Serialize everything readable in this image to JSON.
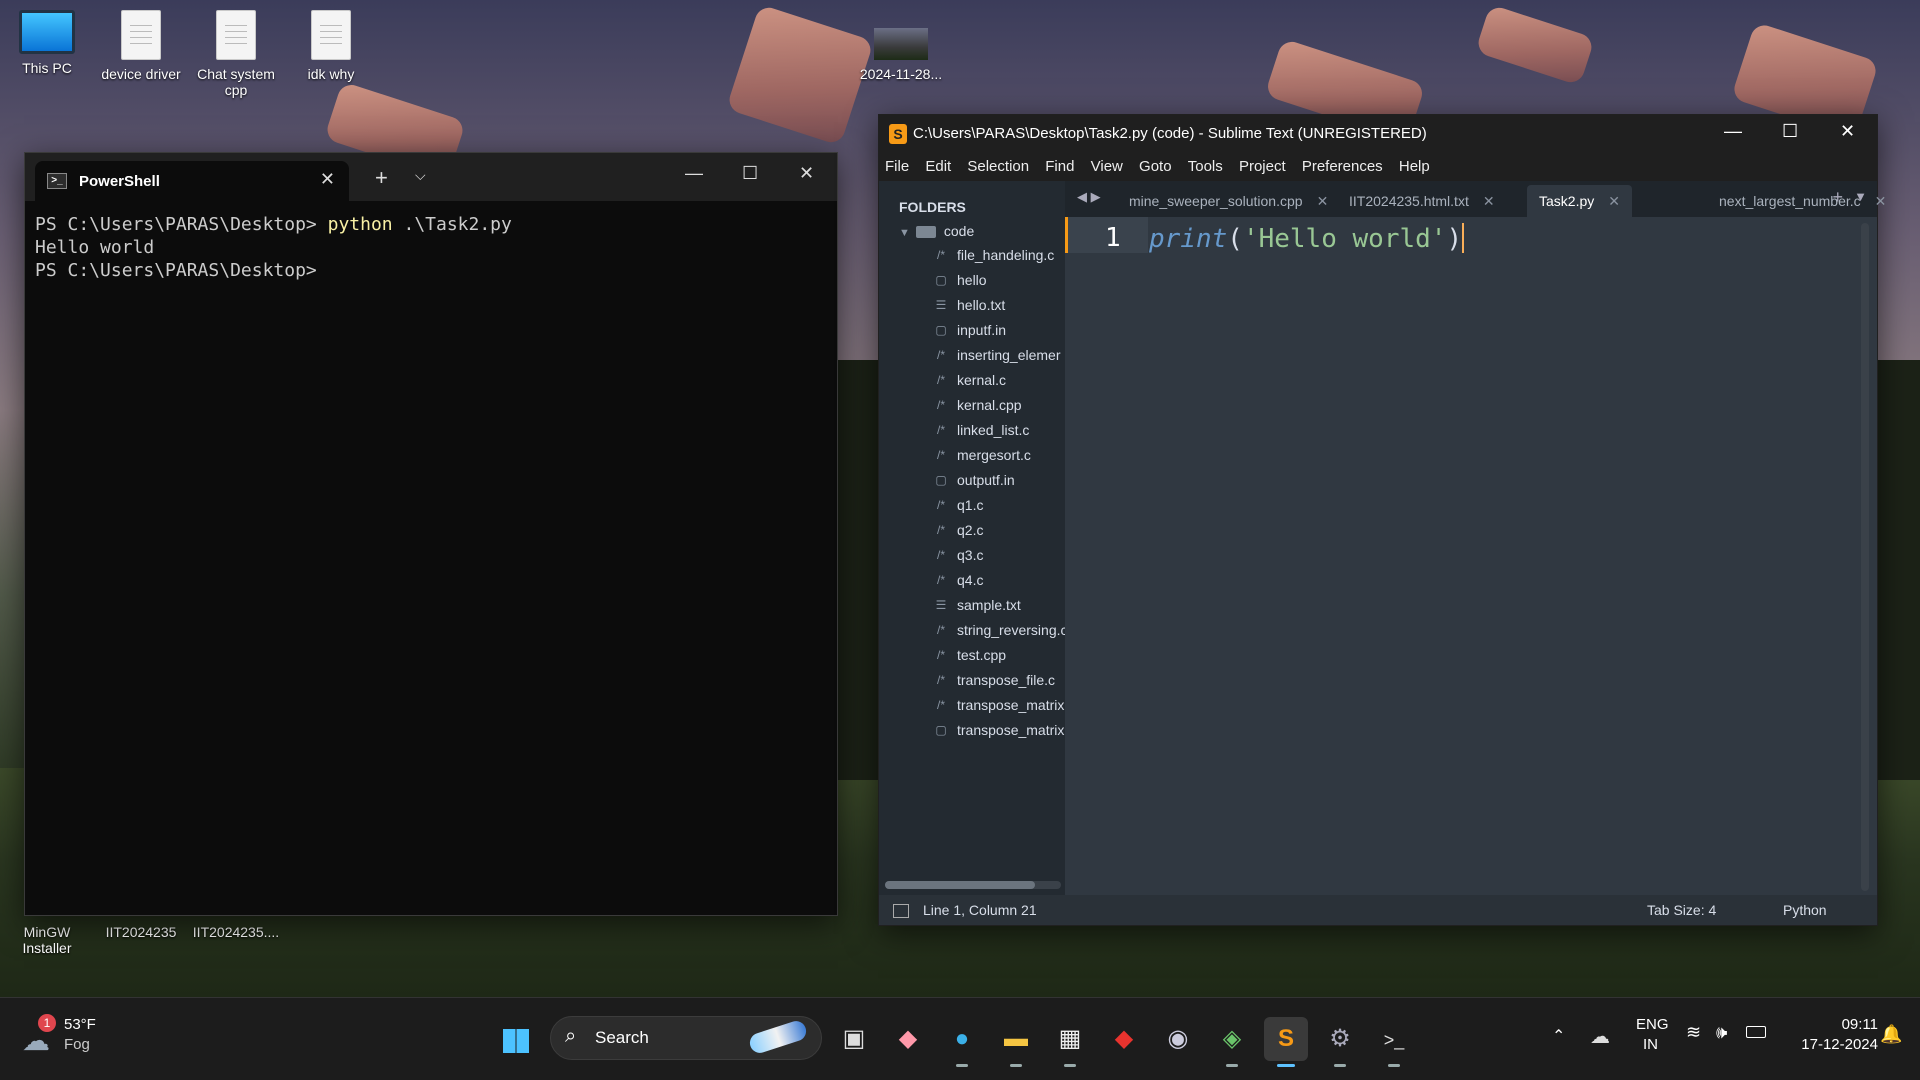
{
  "desktop": {
    "icons": [
      {
        "label": "This PC"
      },
      {
        "label": "device driver"
      },
      {
        "label": "Chat system cpp"
      },
      {
        "label": "idk why"
      },
      {
        "label": "2024-11-28..."
      },
      {
        "label": "MinGW Installer"
      },
      {
        "label": "IIT2024235"
      },
      {
        "label": "IIT2024235...."
      }
    ]
  },
  "powershell": {
    "tab_title": "PowerShell",
    "lines": {
      "prompt1": "PS C:\\Users\\PARAS\\Desktop> ",
      "command": "python",
      "arg": " .\\Task2.py",
      "output": "Hello world",
      "prompt2": "PS C:\\Users\\PARAS\\Desktop>"
    }
  },
  "sublime": {
    "title": "C:\\Users\\PARAS\\Desktop\\Task2.py (code) - Sublime Text (UNREGISTERED)",
    "menu": [
      "File",
      "Edit",
      "Selection",
      "Find",
      "View",
      "Goto",
      "Tools",
      "Project",
      "Preferences",
      "Help"
    ],
    "sidebar": {
      "header": "FOLDERS",
      "folder": "code",
      "files": [
        {
          "name": "file_handeling.c",
          "icon": "/*"
        },
        {
          "name": "hello",
          "icon": "▢"
        },
        {
          "name": "hello.txt",
          "icon": "☰"
        },
        {
          "name": "inputf.in",
          "icon": "▢"
        },
        {
          "name": "inserting_elemer",
          "icon": "/*"
        },
        {
          "name": "kernal.c",
          "icon": "/*"
        },
        {
          "name": "kernal.cpp",
          "icon": "/*"
        },
        {
          "name": "linked_list.c",
          "icon": "/*"
        },
        {
          "name": "mergesort.c",
          "icon": "/*"
        },
        {
          "name": "outputf.in",
          "icon": "▢"
        },
        {
          "name": "q1.c",
          "icon": "/*"
        },
        {
          "name": "q2.c",
          "icon": "/*"
        },
        {
          "name": "q3.c",
          "icon": "/*"
        },
        {
          "name": "q4.c",
          "icon": "/*"
        },
        {
          "name": "sample.txt",
          "icon": "☰"
        },
        {
          "name": "string_reversing.c",
          "icon": "/*"
        },
        {
          "name": "test.cpp",
          "icon": "/*"
        },
        {
          "name": "transpose_file.c",
          "icon": "/*"
        },
        {
          "name": "transpose_matrix",
          "icon": "/*"
        },
        {
          "name": "transpose_matrix",
          "icon": "▢"
        }
      ]
    },
    "tabs": [
      {
        "label": "mine_sweeper_solution.cpp",
        "active": false
      },
      {
        "label": "IIT2024235.html.txt",
        "active": false
      },
      {
        "label": "Task2.py",
        "active": true
      },
      {
        "label": "next_largest_number.c",
        "active": false
      }
    ],
    "editor": {
      "line_number": "1",
      "fn": "print",
      "open": "(",
      "str": "'Hello world'",
      "close": ")"
    },
    "status": {
      "position": "Line 1, Column 21",
      "tab_size": "Tab Size: 4",
      "syntax": "Python"
    }
  },
  "taskbar": {
    "weather_temp": "53°F",
    "weather_desc": "Fog",
    "weather_badge": "1",
    "search_label": "Search",
    "lang1": "ENG",
    "lang2": "IN",
    "time": "09:11",
    "date": "17-12-2024"
  }
}
